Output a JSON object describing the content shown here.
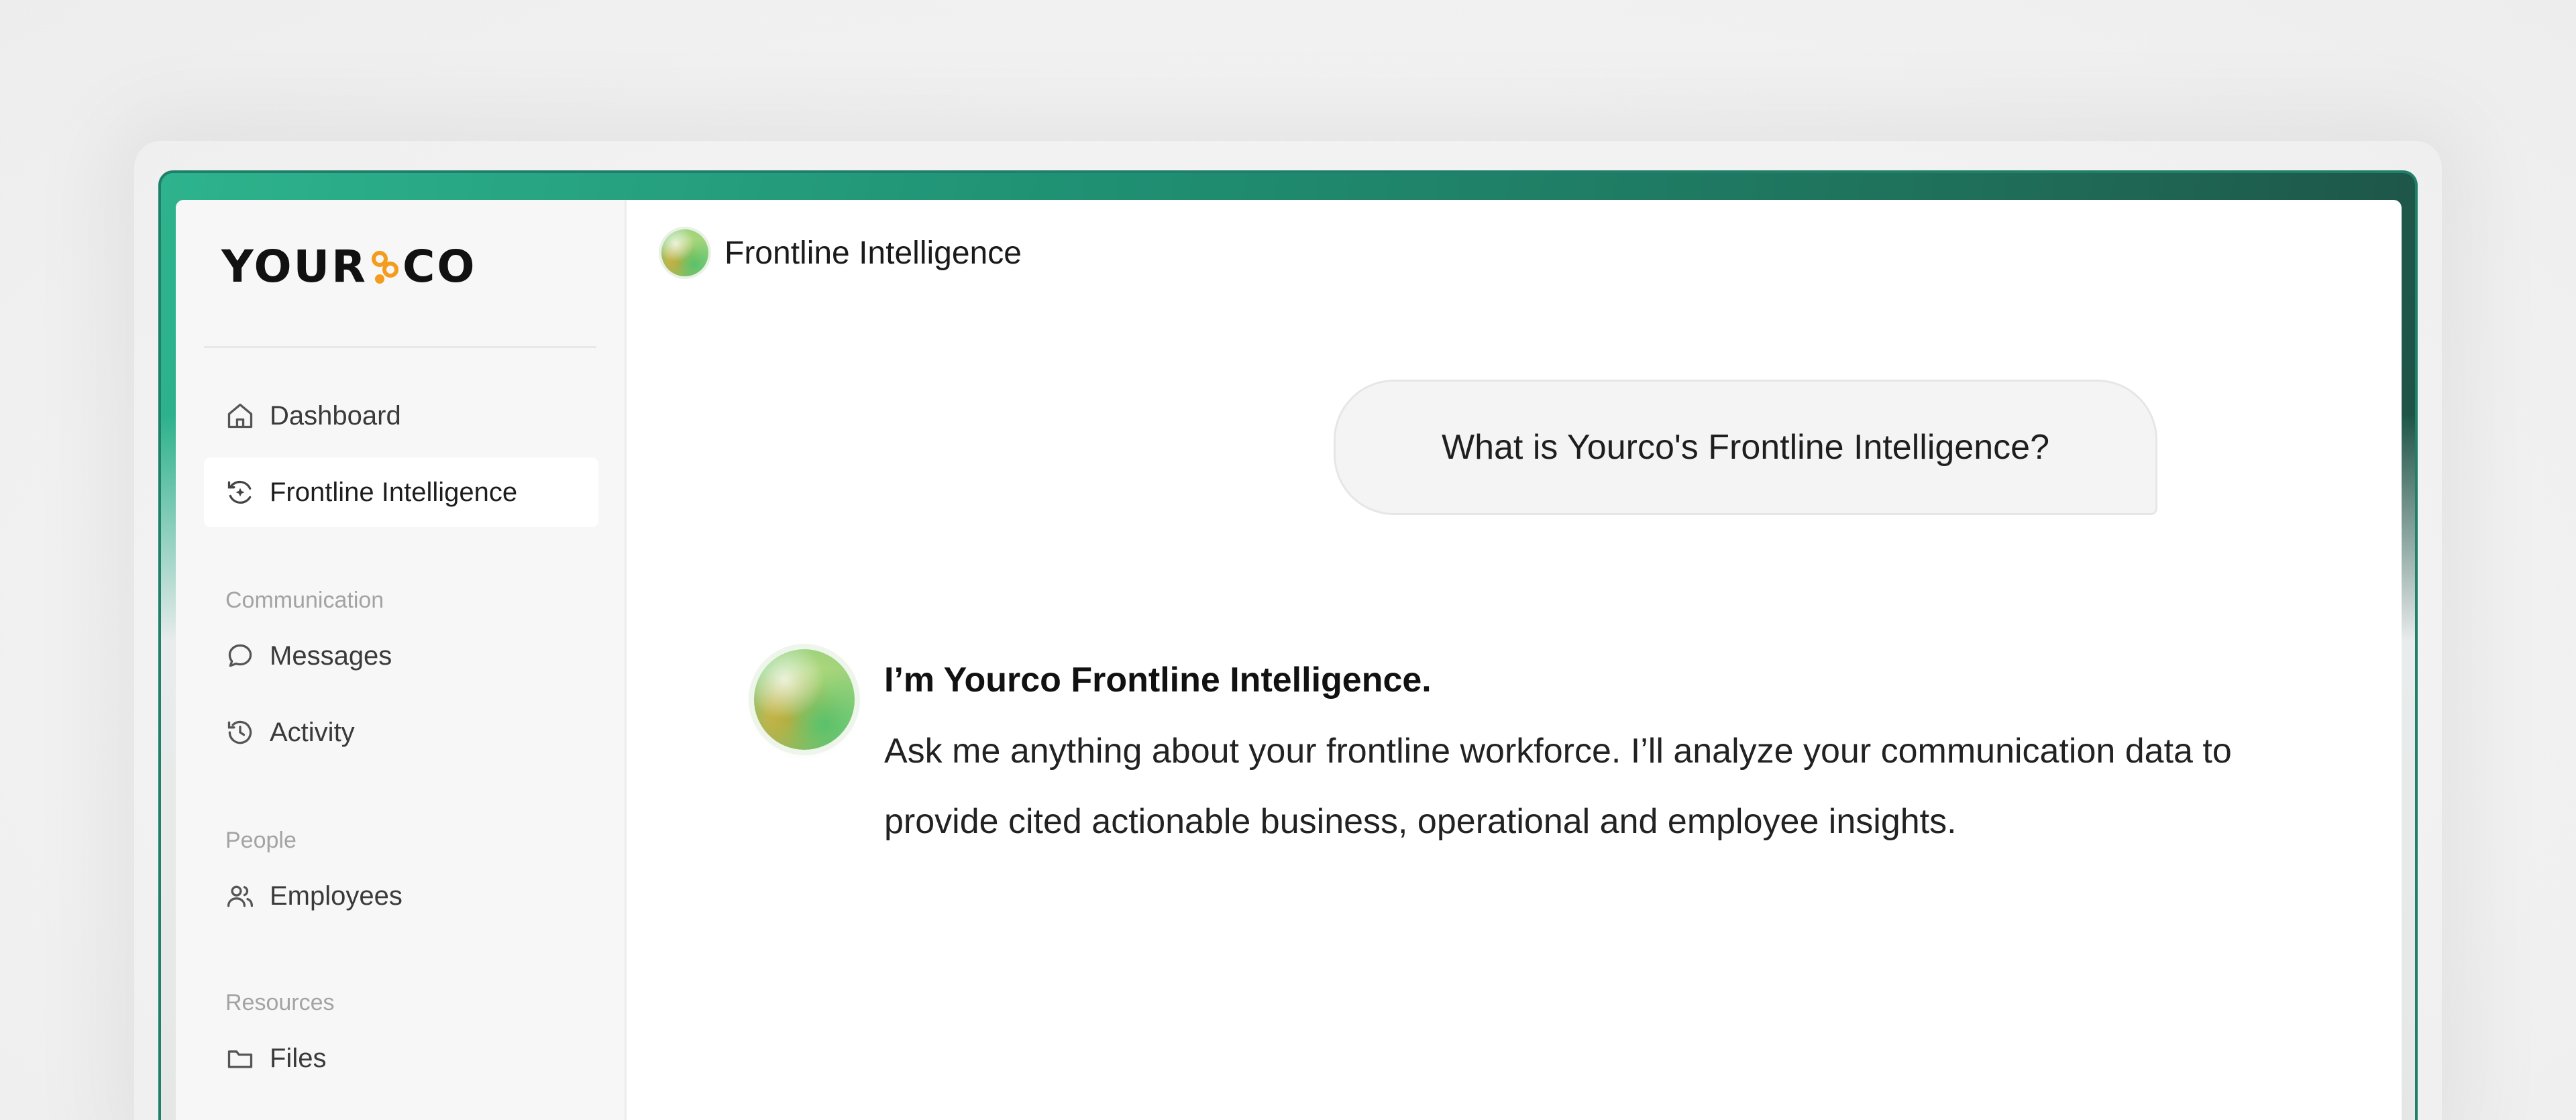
{
  "brand": {
    "logo_left": "YOUR",
    "logo_right": "CO",
    "accent_color": "#f39c1e",
    "frame_color": "#1f8f72"
  },
  "sidebar": {
    "items": [
      {
        "label": "Dashboard",
        "icon": "home-icon",
        "active": false
      },
      {
        "label": "Frontline Intelligence",
        "icon": "sparkle-refresh-icon",
        "active": true
      }
    ],
    "sections": [
      {
        "label": "Communication",
        "items": [
          {
            "label": "Messages",
            "icon": "chat-bubble-icon"
          },
          {
            "label": "Activity",
            "icon": "history-icon"
          }
        ]
      },
      {
        "label": "People",
        "items": [
          {
            "label": "Employees",
            "icon": "users-icon"
          }
        ]
      },
      {
        "label": "Resources",
        "items": [
          {
            "label": "Files",
            "icon": "folder-icon"
          }
        ]
      }
    ]
  },
  "header": {
    "title": "Frontline Intelligence",
    "icon": "ai-orb-icon"
  },
  "chat": {
    "user_message": "What is Yourco's Frontline Intelligence?",
    "assistant": {
      "title": "I’m Yourco Frontline Intelligence.",
      "body": "Ask me anything about your frontline workforce. I’ll analyze your communication data to provide cited actionable business, operational and employee insights."
    }
  }
}
